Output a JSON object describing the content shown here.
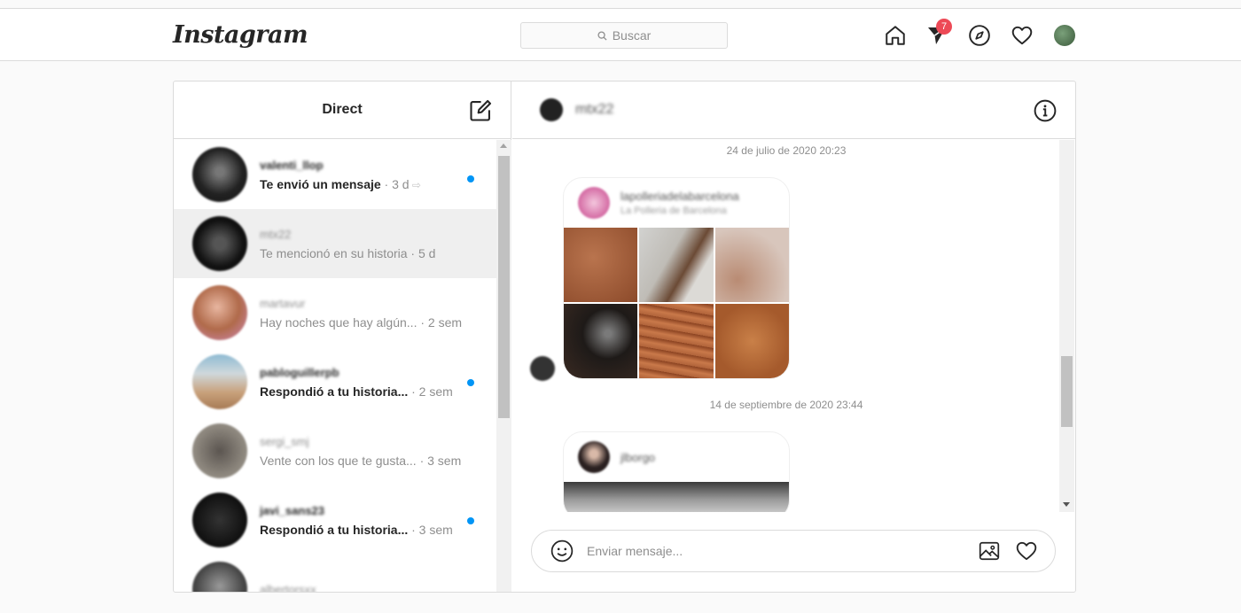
{
  "header": {
    "logo_text": "Instagram",
    "search_placeholder": "Buscar",
    "direct_badge": "7"
  },
  "inbox": {
    "title": "Direct",
    "conversations": [
      {
        "username": "valenti_llop",
        "preview": "Te envió un mensaje",
        "time": " · 3 d",
        "unread": true
      },
      {
        "username": "mtx22",
        "preview": "Te mencionó en su historia",
        "time": " · 5 d",
        "unread": false
      },
      {
        "username": "martavur",
        "preview": "Hay noches que hay algún...",
        "time": " · 2 sem",
        "unread": false
      },
      {
        "username": "pabloguillerpb",
        "preview": "Respondió a tu historia...",
        "time": " · 2 sem",
        "unread": true
      },
      {
        "username": "sergi_smj",
        "preview": "Vente con los que te gusta...",
        "time": " · 3 sem",
        "unread": false
      },
      {
        "username": "javi_sans23",
        "preview": "Respondió a tu historia...",
        "time": " · 3 sem",
        "unread": true
      },
      {
        "username": "albertorsxx",
        "preview": "",
        "time": "",
        "unread": false
      }
    ]
  },
  "chat": {
    "name": "mtx22",
    "messages": [
      {
        "date": "24 de julio de 2020 20:23",
        "card_user": "lapolleriadelabarcelona",
        "card_sub": "La Polleria de Barcelona"
      },
      {
        "date": "14 de septiembre de 2020 23:44",
        "card_user": "jlborgo",
        "card_sub": ""
      }
    ],
    "input_placeholder": "Enviar mensaje..."
  },
  "colors": {
    "unread_dot": "#0095f6",
    "badge": "#ed4956"
  }
}
